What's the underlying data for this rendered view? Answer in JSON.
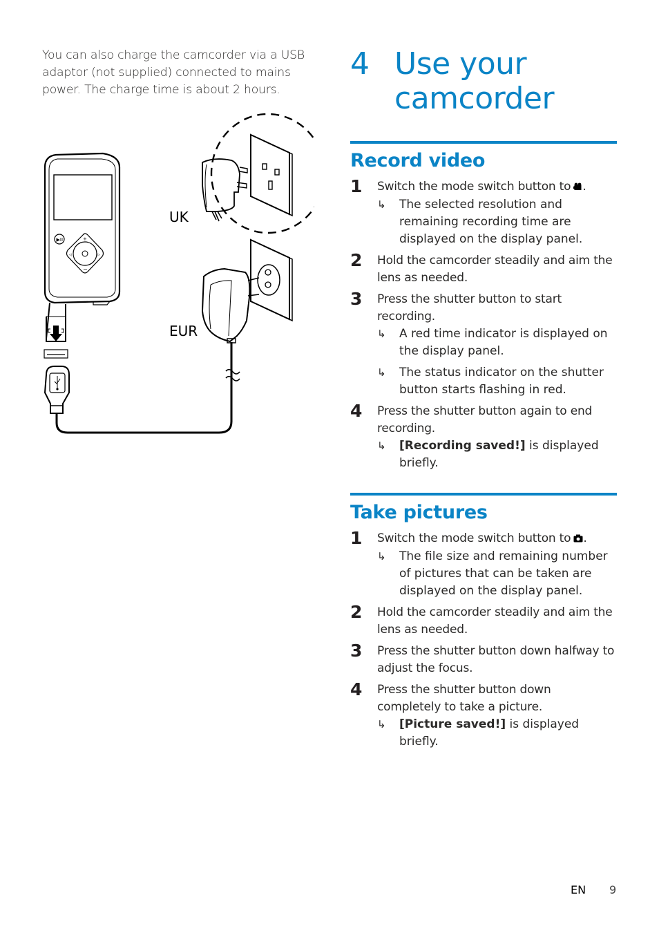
{
  "intro_text": "You can also charge the camcorder via a USB adaptor (not supplied) connected to mains power. The charge time is about 2 hours.",
  "figure": {
    "labels": {
      "uk": "UK",
      "eur": "EUR"
    }
  },
  "chapter": {
    "number": "4",
    "title_line1": "Use your",
    "title_line2": "camcorder"
  },
  "accent_color": "#0b84c6",
  "sections": [
    {
      "title": "Record video",
      "steps": [
        {
          "num": "1",
          "text": "Switch the mode switch button to",
          "icon": "video-camera-icon",
          "suffix": ".",
          "results": [
            "The selected resolution and remaining recording time are displayed on the display panel."
          ]
        },
        {
          "num": "2",
          "text": "Hold the camcorder steadily and aim the lens as needed.",
          "results": []
        },
        {
          "num": "3",
          "text": "Press the shutter button to start recording.",
          "results": [
            "A red time indicator is displayed on the display panel.",
            "The status indicator on the shutter button starts flashing in red."
          ]
        },
        {
          "num": "4",
          "text": "Press the shutter button again to end recording.",
          "results_bold": [
            {
              "bold": "[Recording saved!]",
              "rest": " is displayed briefly."
            }
          ]
        }
      ]
    },
    {
      "title": "Take pictures",
      "steps": [
        {
          "num": "1",
          "text": "Switch the mode switch button to",
          "icon": "photo-camera-icon",
          "suffix": ".",
          "results": [
            "The file size and remaining number of pictures that can be taken are displayed on the display panel."
          ]
        },
        {
          "num": "2",
          "text": "Hold the camcorder steadily and aim the lens as needed.",
          "results": []
        },
        {
          "num": "3",
          "text": "Press the shutter button down halfway to adjust the focus.",
          "results": []
        },
        {
          "num": "4",
          "text": "Press the shutter button down completely to take a picture.",
          "results_bold": [
            {
              "bold": "[Picture saved!]",
              "rest": " is displayed briefly."
            }
          ]
        }
      ]
    }
  ],
  "arrow_glyph": "↳",
  "footer": {
    "lang": "EN",
    "page": "9"
  }
}
